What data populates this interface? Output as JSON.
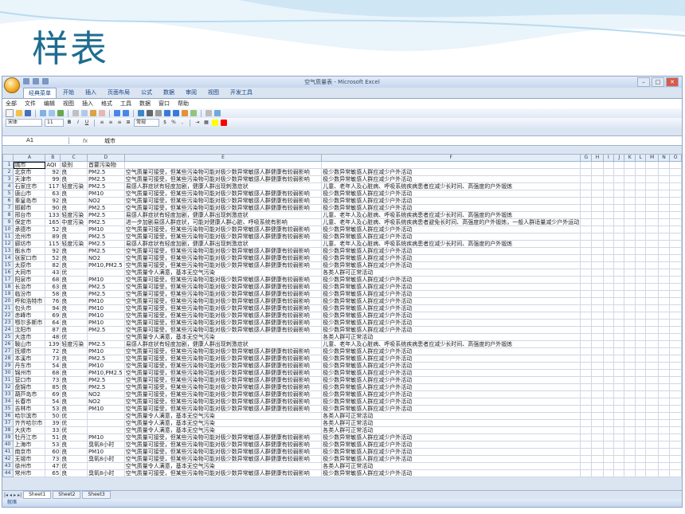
{
  "slide": {
    "title": "样表"
  },
  "excel": {
    "window_title": "空气质量表 - Microsoft Excel",
    "ribbon_tabs": [
      "经典菜单",
      "开始",
      "插入",
      "页面布局",
      "公式",
      "数据",
      "审阅",
      "视图",
      "开发工具"
    ],
    "menu_items": [
      "全部",
      "文件",
      "编辑",
      "视图",
      "插入",
      "格式",
      "工具",
      "数据",
      "窗口",
      "帮助"
    ],
    "font_name": "宋体",
    "font_size": "11",
    "number_format": "常规",
    "name_box": "A1",
    "formula_value": "城市",
    "columns": [
      "A",
      "B",
      "C",
      "D",
      "E",
      "F",
      "G",
      "H",
      "I",
      "J",
      "K",
      "L",
      "M",
      "N",
      "O"
    ],
    "header_row": [
      "城市",
      "AQI",
      "级别",
      "首要污染物",
      "",
      "",
      "",
      "",
      "",
      "",
      "",
      "",
      "",
      "",
      ""
    ],
    "rows": [
      [
        "北京市",
        "92",
        "良",
        "PM2.5",
        "空气质量可接受，但某些污染物可能对极少数异常敏感人群健康有较弱影响",
        "极少数异常敏感人群应减少户外活动"
      ],
      [
        "天津市",
        "99",
        "良",
        "PM2.5",
        "空气质量可接受，但某些污染物可能对极少数异常敏感人群健康有较弱影响",
        "极少数异常敏感人群应减少户外活动"
      ],
      [
        "石家庄市",
        "117",
        "轻度污染",
        "PM2.5",
        "易感人群症状有轻度加剧，健康人群出现刺激症状",
        "儿童、老年人及心脏病、呼吸系统疾病患者应减少长时间、高强度的户外锻炼"
      ],
      [
        "唐山市",
        "63",
        "良",
        "PM10",
        "空气质量可接受，但某些污染物可能对极少数异常敏感人群健康有较弱影响",
        "极少数异常敏感人群应减少户外活动"
      ],
      [
        "秦皇岛市",
        "92",
        "良",
        "NO2",
        "空气质量可接受，但某些污染物可能对极少数异常敏感人群健康有较弱影响",
        "极少数异常敏感人群应减少户外活动"
      ],
      [
        "邯郸市",
        "90",
        "良",
        "PM2.5",
        "空气质量可接受，但某些污染物可能对极少数异常敏感人群健康有较弱影响",
        "极少数异常敏感人群应减少户外活动"
      ],
      [
        "邢台市",
        "133",
        "轻度污染",
        "PM2.5",
        "易感人群症状有轻度加剧，健康人群出现刺激症状",
        "儿童、老年人及心脏病、呼吸系统疾病患者应减少长时间、高强度的户外锻炼"
      ],
      [
        "保定市",
        "165",
        "中度污染",
        "PM2.5",
        "进一步加剧易感人群症状，可能对健康人群心脏、呼吸系统有影响",
        "儿童、老年人及心脏病、呼吸系统疾病患者避免长时间、高强度的户外锻炼，一般人群适量减少户外运动"
      ],
      [
        "承德市",
        "52",
        "良",
        "PM10",
        "空气质量可接受，但某些污染物可能对极少数异常敏感人群健康有较弱影响",
        "极少数异常敏感人群应减少户外活动"
      ],
      [
        "沧州市",
        "89",
        "良",
        "PM2.5",
        "空气质量可接受，但某些污染物可能对极少数异常敏感人群健康有较弱影响",
        "极少数异常敏感人群应减少户外活动"
      ],
      [
        "廊坊市",
        "115",
        "轻度污染",
        "PM2.5",
        "易感人群症状有轻度加剧，健康人群出现刺激症状",
        "儿童、老年人及心脏病、呼吸系统疾病患者应减少长时间、高强度的户外锻炼"
      ],
      [
        "衡水市",
        "92",
        "良",
        "PM2.5",
        "空气质量可接受，但某些污染物可能对极少数异常敏感人群健康有较弱影响",
        "极少数异常敏感人群应减少户外活动"
      ],
      [
        "张家口市",
        "52",
        "良",
        "NO2",
        "空气质量可接受，但某些污染物可能对极少数异常敏感人群健康有较弱影响",
        "极少数异常敏感人群应减少户外活动"
      ],
      [
        "太原市",
        "82",
        "良",
        "PM10,PM2.5",
        "空气质量可接受，但某些污染物可能对极少数异常敏感人群健康有较弱影响",
        "极少数异常敏感人群应减少户外活动"
      ],
      [
        "大同市",
        "43",
        "优",
        "",
        "空气质量令人满意，基本无空气污染",
        "各类人群可正常活动"
      ],
      [
        "阳泉市",
        "68",
        "良",
        "PM10",
        "空气质量可接受，但某些污染物可能对极少数异常敏感人群健康有较弱影响",
        "极少数异常敏感人群应减少户外活动"
      ],
      [
        "长治市",
        "63",
        "良",
        "PM2.5",
        "空气质量可接受，但某些污染物可能对极少数异常敏感人群健康有较弱影响",
        "极少数异常敏感人群应减少户外活动"
      ],
      [
        "临汾市",
        "58",
        "良",
        "PM2.5",
        "空气质量可接受，但某些污染物可能对极少数异常敏感人群健康有较弱影响",
        "极少数异常敏感人群应减少户外活动"
      ],
      [
        "呼和浩特市",
        "76",
        "良",
        "PM10",
        "空气质量可接受，但某些污染物可能对极少数异常敏感人群健康有较弱影响",
        "极少数异常敏感人群应减少户外活动"
      ],
      [
        "包头市",
        "94",
        "良",
        "PM10",
        "空气质量可接受，但某些污染物可能对极少数异常敏感人群健康有较弱影响",
        "极少数异常敏感人群应减少户外活动"
      ],
      [
        "赤峰市",
        "69",
        "良",
        "PM10",
        "空气质量可接受，但某些污染物可能对极少数异常敏感人群健康有较弱影响",
        "极少数异常敏感人群应减少户外活动"
      ],
      [
        "鄂尔多斯市",
        "64",
        "良",
        "PM10",
        "空气质量可接受，但某些污染物可能对极少数异常敏感人群健康有较弱影响",
        "极少数异常敏感人群应减少户外活动"
      ],
      [
        "沈阳市",
        "87",
        "良",
        "PM2.5",
        "空气质量可接受，但某些污染物可能对极少数异常敏感人群健康有较弱影响",
        "极少数异常敏感人群应减少户外活动"
      ],
      [
        "大连市",
        "48",
        "优",
        "",
        "空气质量令人满意，基本无空气污染",
        "各类人群可正常活动"
      ],
      [
        "鞍山市",
        "139",
        "轻度污染",
        "PM2.5",
        "易感人群症状有轻度加剧，健康人群出现刺激症状",
        "儿童、老年人及心脏病、呼吸系统疾病患者应减少长时间、高强度的户外锻炼"
      ],
      [
        "抚顺市",
        "72",
        "良",
        "PM10",
        "空气质量可接受，但某些污染物可能对极少数异常敏感人群健康有较弱影响",
        "极少数异常敏感人群应减少户外活动"
      ],
      [
        "本溪市",
        "73",
        "良",
        "PM2.5",
        "空气质量可接受，但某些污染物可能对极少数异常敏感人群健康有较弱影响",
        "极少数异常敏感人群应减少户外活动"
      ],
      [
        "丹东市",
        "54",
        "良",
        "PM10",
        "空气质量可接受，但某些污染物可能对极少数异常敏感人群健康有较弱影响",
        "极少数异常敏感人群应减少户外活动"
      ],
      [
        "锦州市",
        "68",
        "良",
        "PM10,PM2.5",
        "空气质量可接受，但某些污染物可能对极少数异常敏感人群健康有较弱影响",
        "极少数异常敏感人群应减少户外活动"
      ],
      [
        "营口市",
        "73",
        "良",
        "PM2.5",
        "空气质量可接受，但某些污染物可能对极少数异常敏感人群健康有较弱影响",
        "极少数异常敏感人群应减少户外活动"
      ],
      [
        "盘锦市",
        "85",
        "良",
        "PM2.5",
        "空气质量可接受，但某些污染物可能对极少数异常敏感人群健康有较弱影响",
        "极少数异常敏感人群应减少户外活动"
      ],
      [
        "葫芦岛市",
        "69",
        "良",
        "NO2",
        "空气质量可接受，但某些污染物可能对极少数异常敏感人群健康有较弱影响",
        "极少数异常敏感人群应减少户外活动"
      ],
      [
        "长春市",
        "54",
        "良",
        "NO2",
        "空气质量可接受，但某些污染物可能对极少数异常敏感人群健康有较弱影响",
        "极少数异常敏感人群应减少户外活动"
      ],
      [
        "吉林市",
        "53",
        "良",
        "PM10",
        "空气质量可接受，但某些污染物可能对极少数异常敏感人群健康有较弱影响",
        "极少数异常敏感人群应减少户外活动"
      ],
      [
        "哈尔滨市",
        "50",
        "优",
        "",
        "空气质量令人满意，基本无空气污染",
        "各类人群可正常活动"
      ],
      [
        "齐齐哈尔市",
        "39",
        "优",
        "",
        "空气质量令人满意，基本无空气污染",
        "各类人群可正常活动"
      ],
      [
        "大庆市",
        "33",
        "优",
        "",
        "空气质量令人满意，基本无空气污染",
        "各类人群可正常活动"
      ],
      [
        "牡丹江市",
        "51",
        "良",
        "PM10",
        "空气质量可接受，但某些污染物可能对极少数异常敏感人群健康有较弱影响",
        "极少数异常敏感人群应减少户外活动"
      ],
      [
        "上海市",
        "53",
        "良",
        "臭氧8小时",
        "空气质量可接受，但某些污染物可能对极少数异常敏感人群健康有较弱影响",
        "极少数异常敏感人群应减少户外活动"
      ],
      [
        "南京市",
        "60",
        "良",
        "PM10",
        "空气质量可接受，但某些污染物可能对极少数异常敏感人群健康有较弱影响",
        "极少数异常敏感人群应减少户外活动"
      ],
      [
        "无锡市",
        "73",
        "良",
        "臭氧8小时",
        "空气质量可接受，但某些污染物可能对极少数异常敏感人群健康有较弱影响",
        "极少数异常敏感人群应减少户外活动"
      ],
      [
        "徐州市",
        "47",
        "优",
        "",
        "空气质量令人满意，基本无空气污染",
        "各类人群可正常活动"
      ],
      [
        "常州市",
        "65",
        "良",
        "臭氧8小时",
        "空气质量可接受，但某些污染物可能对极少数异常敏感人群健康有较弱影响",
        "极少数异常敏感人群应减少户外活动"
      ]
    ],
    "sheet_tabs": [
      "Sheet1",
      "Sheet2",
      "Sheet3"
    ],
    "status": "就绪"
  }
}
